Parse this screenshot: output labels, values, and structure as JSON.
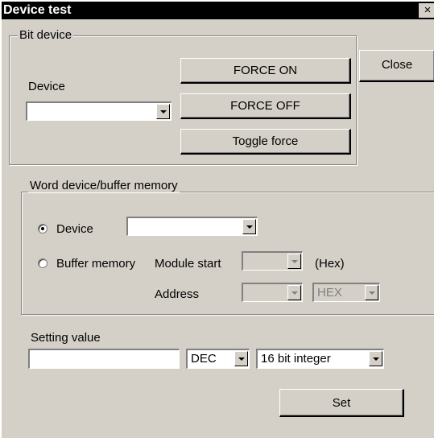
{
  "window": {
    "title": "Device test",
    "close_glyph": "×"
  },
  "bit_device": {
    "legend": "Bit device",
    "device_label": "Device",
    "device_value": "",
    "force_on_label": "FORCE ON",
    "force_off_label": "FORCE OFF",
    "toggle_force_label": "Toggle force"
  },
  "close_button_label": "Close",
  "word_device": {
    "legend": "Word device/buffer memory",
    "device_radio_label": "Device",
    "device_radio_checked": true,
    "device_value": "",
    "buffer_radio_label": "Buffer memory",
    "buffer_radio_checked": false,
    "module_start_label": "Module start",
    "module_start_value": "",
    "hex_suffix": "(Hex)",
    "address_label": "Address",
    "address_value": "",
    "address_format_value": "HEX"
  },
  "setting_value": {
    "label": "Setting value",
    "input_value": "",
    "radix_value": "DEC",
    "type_value": "16 bit integer",
    "set_button_label": "Set"
  },
  "icons": [
    "close-icon",
    "chevron-down-icon",
    "radio-icon"
  ]
}
